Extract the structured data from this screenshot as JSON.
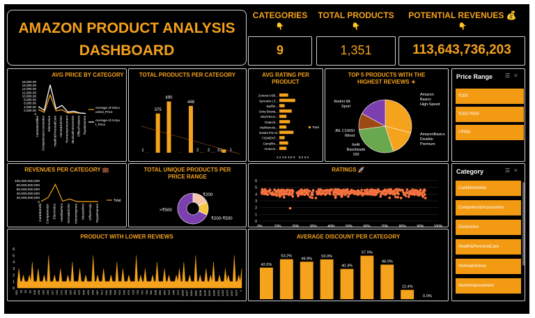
{
  "title": {
    "line1": "AMAZON PRODUCT ANALYSIS",
    "line2": "DASHBOARD"
  },
  "kpis": [
    {
      "title": "CATEGORIES",
      "value": "9"
    },
    {
      "title": "TOTAL PRODUCTS",
      "value": "1,351"
    },
    {
      "title": "POTENTIAL REVENUES",
      "value": "113,643,736,203"
    }
  ],
  "colors": {
    "accent": "#f5a21c",
    "background": "#000000",
    "border": "#cfcfcf",
    "purple": "#7b3fb0",
    "green": "#6aa84f",
    "brown": "#9c4a12",
    "salmon": "#ff7a4a"
  },
  "icons": {
    "kpi_pointer": "pointing-hand-icon",
    "revenue": "money-bag-icon",
    "revenues_category": "briefcase-icon",
    "ratings": "rocket-icon",
    "top5": "star-icon"
  },
  "panels": {
    "avg_price": "AVG PRICE BY CATEGORY",
    "total_products": "TOTAL PRODUCTS PER CATEGORY",
    "avg_rating": "AVG RATING PER PRODUCT",
    "top5": "TOP 5 PRODUCTS WITH THE HIGHEST REVIEWS",
    "revenues": "REVENUES PER CATEGORY",
    "unique_price": "TOTAL UNIQUE PRODUCTS PER PRICE RANGE",
    "ratings": "RATINGS",
    "lower_reviews": "PRODUCT WITH LOWER REVIEWS",
    "avg_discount": "AVERAGE DISCOUNT PER CATEGORY"
  },
  "slicers": {
    "price": {
      "title": "Price Range",
      "items": [
        "₹200",
        "₹200-₹500",
        ">₹500"
      ]
    },
    "category": {
      "title": "Category",
      "items": [
        "Car&Motorbike",
        "Computers&Accessories",
        "Electronics",
        "Health&PersonalCare",
        "Home&Kitchen",
        "HomeImprovement"
      ]
    }
  },
  "chart_data": [
    {
      "id": "avg_price",
      "type": "line",
      "categories": [
        "Car&Motorbike",
        "Computers&Accessories",
        "Electronics",
        "Health&PersonalCare",
        "Home&Kitchen",
        "HomeImprovement",
        "MusicalInstruments",
        "OfficeProducts",
        "Toys&Games"
      ],
      "series": [
        {
          "name": "Average of Discounted_Price",
          "values": [
            2300,
            800,
            10500,
            1600,
            2200,
            340,
            640,
            300,
            150
          ]
        },
        {
          "name": "Average of Actual_Price",
          "values": [
            4000,
            1900,
            16200,
            2800,
            4600,
            900,
            1400,
            400,
            150
          ]
        }
      ],
      "y_ticks": [
        "0",
        "2,000.00",
        "4,000.00",
        "6,000.00",
        "8,000.00",
        "10,000.00",
        "12,000.00",
        "14,000.00",
        "16,000.00",
        "18,000.00"
      ],
      "ylim": [
        0,
        18000
      ],
      "legend": "right"
    },
    {
      "id": "total_products",
      "type": "bar",
      "values": [
        1,
        375,
        490,
        1,
        448,
        2,
        2,
        31,
        1
      ],
      "labels": [
        "1",
        "375",
        "490",
        "",
        "448",
        "2",
        "2",
        "31",
        "1"
      ],
      "trendline": true,
      "ylim": [
        0,
        520
      ]
    },
    {
      "id": "avg_rating",
      "type": "bar",
      "categories": [
        "Zuvexa USB...",
        "Syncwire LT...",
        "Swiffer...",
        "Sony Bravia...",
        "REDTECH...",
        "Oratech...",
        "Multifunctio...",
        "Instant Pot Air",
        "FIGMENT...",
        "Campfire...",
        "Amazon..."
      ],
      "values": [
        4.5,
        4.9,
        4.3,
        4.7,
        4.4,
        4.6,
        4.4,
        4.8,
        4.3,
        4.5,
        4.4
      ],
      "x_ticks": [
        "4.4",
        "4.6",
        "4.8",
        "5",
        "5.2",
        "5.4"
      ],
      "xlim": [
        4.0,
        5.5
      ],
      "legend": "Total"
    },
    {
      "id": "top5",
      "type": "pie",
      "labels": [
        "Amazon Basics High-Speed",
        "AmazonBasics Flexible Premium",
        "boAt Bassheads 100",
        "JBL C100SI Wired",
        "Redmi 9A Sport"
      ],
      "values": [
        29,
        16,
        28,
        10,
        17
      ],
      "colors": [
        "#f5a21c",
        "#f5a21c",
        "#6aa84f",
        "#9c4a12",
        "#7b3fb0"
      ]
    },
    {
      "id": "revenues",
      "type": "line",
      "categories": [
        "Car&Motorbike",
        "Computers&Accessories",
        "Electronics",
        "Health&PersonalCare",
        "Home&Kitchen",
        "HomeImprovement",
        "MusicalInstruments",
        "OfficeProducts",
        "Toys&Games"
      ],
      "series": [
        {
          "name": "Total",
          "values": [
            200000000,
            20000000000,
            82000000000,
            2000000000,
            12000000000,
            100000000,
            100000000,
            100000000,
            50000000
          ]
        }
      ],
      "y_ticks": [
        "0",
        "20,000,000,000",
        "40,000,000,000",
        "60,000,000,000",
        "80,000,000,000",
        "100,000,000,000"
      ],
      "ylim": [
        0,
        100000000000
      ],
      "legend": "right"
    },
    {
      "id": "unique_price",
      "type": "pie",
      "labels": [
        "₹200",
        "₹200-₹500",
        ">₹500"
      ],
      "values": [
        18,
        14,
        68
      ],
      "colors": [
        "#f3c4a8",
        "#f5c542",
        "#7b3fb0"
      ]
    },
    {
      "id": "ratings",
      "type": "scatter",
      "x_ticks": [
        "0%",
        "10%",
        "20%",
        "30%",
        "40%",
        "50%",
        "60%",
        "70%",
        "80%",
        "90%",
        "100%"
      ],
      "y_ticks": [
        "0",
        "1",
        "2",
        "3",
        "4",
        "5",
        "6"
      ],
      "ylim": [
        0,
        6
      ],
      "xlim": [
        0,
        100
      ],
      "rating_band": [
        3.4,
        4.9
      ],
      "outlier": {
        "x": 17,
        "y": 1.9
      }
    },
    {
      "id": "lower_reviews",
      "type": "area",
      "y_ticks": [
        "0",
        "1",
        "2",
        "3",
        "4",
        "5",
        "6"
      ],
      "ylim": [
        0,
        6
      ],
      "values": [
        1,
        3,
        1,
        1,
        2,
        1,
        1,
        1,
        2,
        1,
        4,
        1,
        1,
        1,
        3,
        1,
        1,
        1,
        2,
        1,
        1,
        5,
        1,
        1,
        1,
        2,
        1,
        1,
        1,
        3,
        1,
        1,
        1,
        1,
        2,
        1,
        1,
        4,
        1,
        1,
        1,
        1,
        3,
        1,
        1,
        1,
        2,
        1,
        1,
        1,
        1,
        5,
        1,
        1,
        2,
        1,
        1,
        1,
        3,
        1,
        1,
        1,
        1,
        2,
        1,
        1,
        1,
        4,
        1,
        1,
        1,
        3,
        1,
        1,
        1,
        2,
        1,
        1,
        1,
        1,
        5,
        1,
        1,
        2,
        1,
        1,
        3,
        1,
        1,
        1,
        1,
        2,
        1,
        1,
        4,
        1,
        1,
        1,
        1,
        3,
        1,
        1,
        2,
        1,
        1,
        1,
        1,
        2,
        1,
        3,
        1,
        1,
        4,
        1,
        1,
        1,
        2,
        1,
        1,
        1,
        5,
        1,
        1,
        2,
        1,
        1,
        1,
        3,
        1,
        1,
        2,
        1,
        4,
        1,
        1,
        1,
        2,
        1,
        1,
        1,
        3,
        1,
        2,
        1,
        1,
        1,
        5,
        1,
        1,
        2,
        1,
        3
      ],
      "x_labels": [
        "992",
        "28",
        "55",
        "82",
        "109",
        "136",
        "163",
        "190",
        "217",
        "244",
        "271",
        "298",
        "325",
        "352",
        "379",
        "406",
        "433",
        "460",
        "487",
        "514",
        "541",
        "568",
        "595",
        "622",
        "649",
        "676",
        "703",
        "730",
        "757",
        "784",
        "811",
        "838",
        "865",
        "892",
        "919",
        "946",
        "973",
        "1000",
        "1027",
        "1054",
        "1081",
        "1108",
        "1135",
        "1162",
        "1189",
        "1216",
        "1243",
        "1270",
        "1297",
        "1324",
        "2"
      ]
    },
    {
      "id": "avg_discount",
      "type": "bar",
      "values": [
        42.0,
        53.2,
        49.9,
        53.0,
        40.3,
        57.9,
        46.0,
        12.4,
        0.0
      ],
      "labels": [
        "42.0%",
        "53.2%",
        "49.9%",
        "53.0%",
        "40.3%",
        "57.9%",
        "46.0%",
        "12.4%",
        "0.0%"
      ],
      "ylim": [
        0,
        65
      ]
    }
  ]
}
